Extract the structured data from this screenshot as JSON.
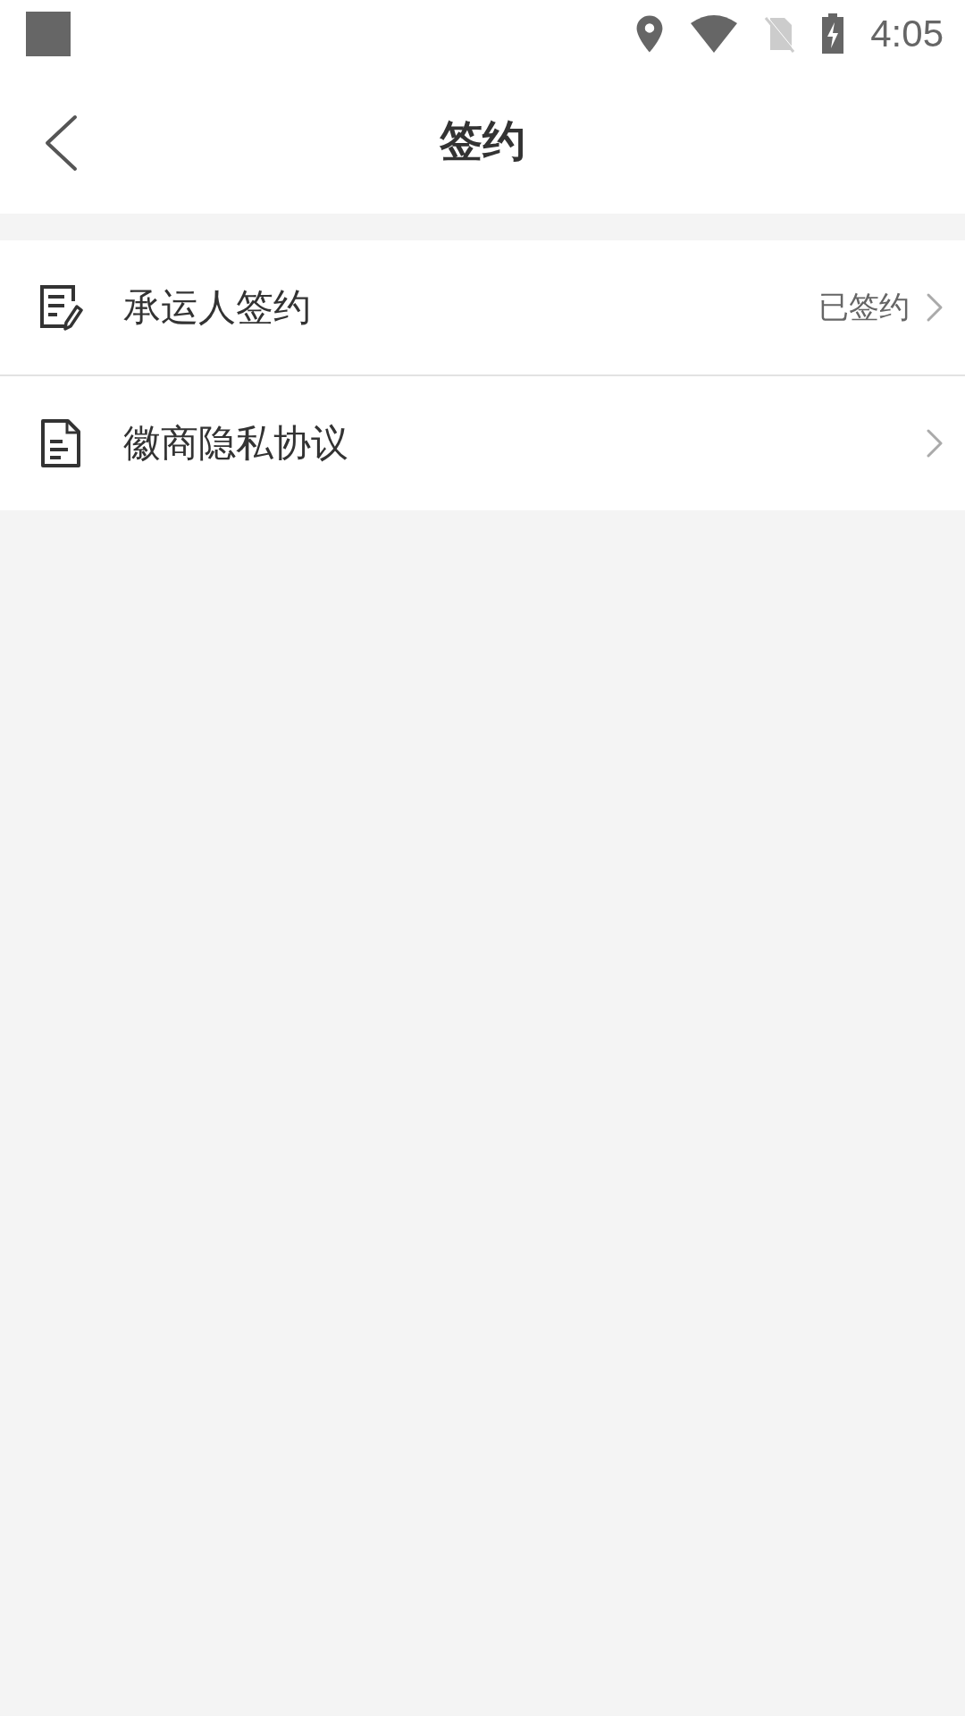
{
  "status_bar": {
    "time": "4:05"
  },
  "header": {
    "title": "签约"
  },
  "items": [
    {
      "kind": "sign",
      "label": "承运人签约",
      "status": "已签约"
    },
    {
      "kind": "document",
      "label": "徽商隐私协议"
    }
  ]
}
